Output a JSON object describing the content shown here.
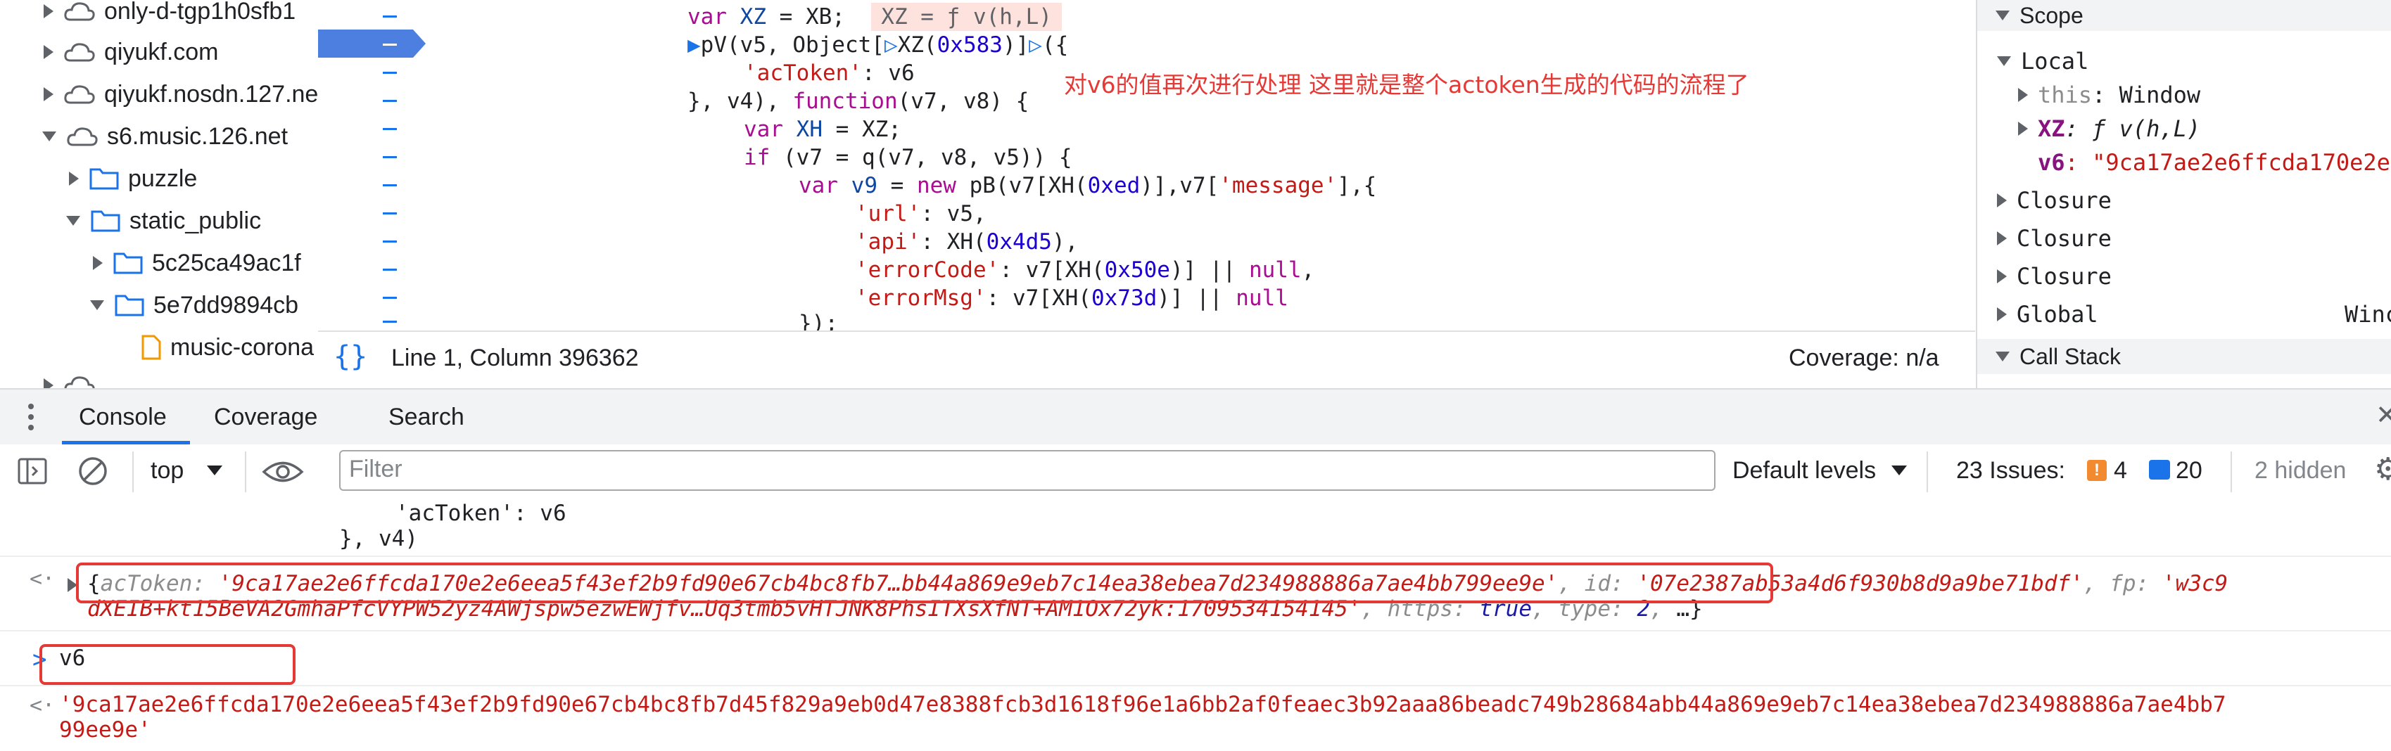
{
  "file_tree": [
    {
      "label": "only-d-tgp1h0sfb1",
      "expanded": false,
      "type": "cloud"
    },
    {
      "label": "qiyukf.com",
      "expanded": false,
      "type": "cloud"
    },
    {
      "label": "qiyukf.nosdn.127.net",
      "expanded": false,
      "type": "cloud"
    },
    {
      "label": "s6.music.126.net",
      "expanded": true,
      "type": "cloud"
    },
    {
      "label": "puzzle",
      "expanded": false,
      "type": "folder"
    },
    {
      "label": "static_public",
      "expanded": true,
      "type": "folder"
    },
    {
      "label": "5c25ca49ac1f",
      "expanded": false,
      "type": "folder"
    },
    {
      "label": "5e7dd9894cb",
      "expanded": true,
      "type": "folder"
    },
    {
      "label": "music-corona",
      "expanded": false,
      "type": "file"
    }
  ],
  "code": {
    "line0": {
      "a": "var ",
      "b": "XZ",
      "c": " = XB;",
      "inline_value": "XZ = ƒ v(h,L)"
    },
    "line1": {
      "a": "pV(v5, Object[",
      "b": "XZ(",
      "c": "0x583",
      "d": ")]",
      "e": "({"
    },
    "line2": {
      "a": "'acToken'",
      "b": ": v6"
    },
    "line3": {
      "a": "}, v4), ",
      "b": "function",
      "c": "(v7, v8) {"
    },
    "line4": {
      "a": "var ",
      "b": "XH",
      "c": " = XZ;"
    },
    "line5": {
      "a": "if",
      "b": " (v7 = q(v7, v8, v5)) {"
    },
    "line6": {
      "a": "var ",
      "b": "v9",
      "c": " = ",
      "d": "new",
      "e": " pB(v7[XH(",
      "f": "0xed",
      "g": ")],v7[",
      "h": "'message'",
      "i": "],{"
    },
    "line7": {
      "a": "'url'",
      "b": ": v5,"
    },
    "line8": {
      "a": "'api'",
      "b": ": XH(",
      "c": "0x4d5",
      "d": "),"
    },
    "line9": {
      "a": "'errorCode'",
      "b": ": v7[XH(",
      "c": "0x50e",
      "d": ")] || ",
      "e": "null",
      ",": ","
    },
    "line10": {
      "a": "'errorMsg'",
      "b": ": v7[XH(",
      "c": "0x73d",
      "d": ")] || ",
      "e": "null"
    },
    "line11": {
      "a": "});"
    }
  },
  "annotation": "对v6的值再次进行处理 这里就是整个actoken生成的代码的流程了",
  "status_bar": {
    "position": "Line 1, Column 396362",
    "coverage": "Coverage: n/a"
  },
  "scope": {
    "scope_header": "Scope",
    "local_header": "Local",
    "this_key": "this",
    "this_val": ": Window",
    "xz_key": "XZ",
    "xz_val": ": ƒ v(h,L)",
    "v6_key": "v6",
    "v6_val": ": \"9ca17ae2e6ffcda170e2e",
    "closures": [
      "Closure",
      "Closure",
      "Closure"
    ],
    "global": "Global",
    "global_val": "Winc",
    "callstack_header": "Call Stack"
  },
  "drawer_tabs": [
    "Console",
    "Coverage",
    "Search"
  ],
  "toolbar": {
    "context": "top",
    "filter_placeholder": "Filter",
    "levels": "Default levels",
    "issues_label": "23 Issues:",
    "issues_errors": "4",
    "issues_info": "20",
    "hidden": "2 hidden"
  },
  "console": {
    "echo1": "'acToken': v6",
    "echo2": "}, v4)",
    "obj_open": "{",
    "k_actoken": "acToken",
    "v_actoken": "'9ca17ae2e6ffcda170e2e6eea5f43ef2b9fd90e67cb4bc8fb7…bb44a869e9eb7c14ea38ebea7d234988886a7ae4bb799ee9e'",
    "k_id": "id",
    "v_id": "'07e2387ab53a4d6f930b8d9a9be71bdf'",
    "k_fp": "fp",
    "v_fp_start": "'w3c9",
    "v_fp_cont": "dXEIB+kt15BeVA2GmhaPfcVYPW52yz4AWjspw5ezwEWjfv…Uq3tmb5vHTJNK8PhsITXsXfNT+AM1Ox72yk:1709534154145'",
    "k_https": "https",
    "v_https": "true",
    "k_type": "type",
    "v_type": "2",
    "obj_close": "…}",
    "input": "v6",
    "result_line1": "'9ca17ae2e6ffcda170e2e6eea5f43ef2b9fd90e67cb4bc8fb7d45f829a9eb0d47e8388fcb3d1618f96e1a6bb2af0feaec3b92aaa86beadc749b28684abb44a869e9eb7c14ea38ebea7d234988886a7ae4bb7",
    "result_line2": "99ee9e'"
  },
  "colors": {
    "accent": "#1a73e8",
    "annotation_red": "#e53935",
    "string_red": "#c41a16",
    "highlight": "#fff8c4"
  }
}
